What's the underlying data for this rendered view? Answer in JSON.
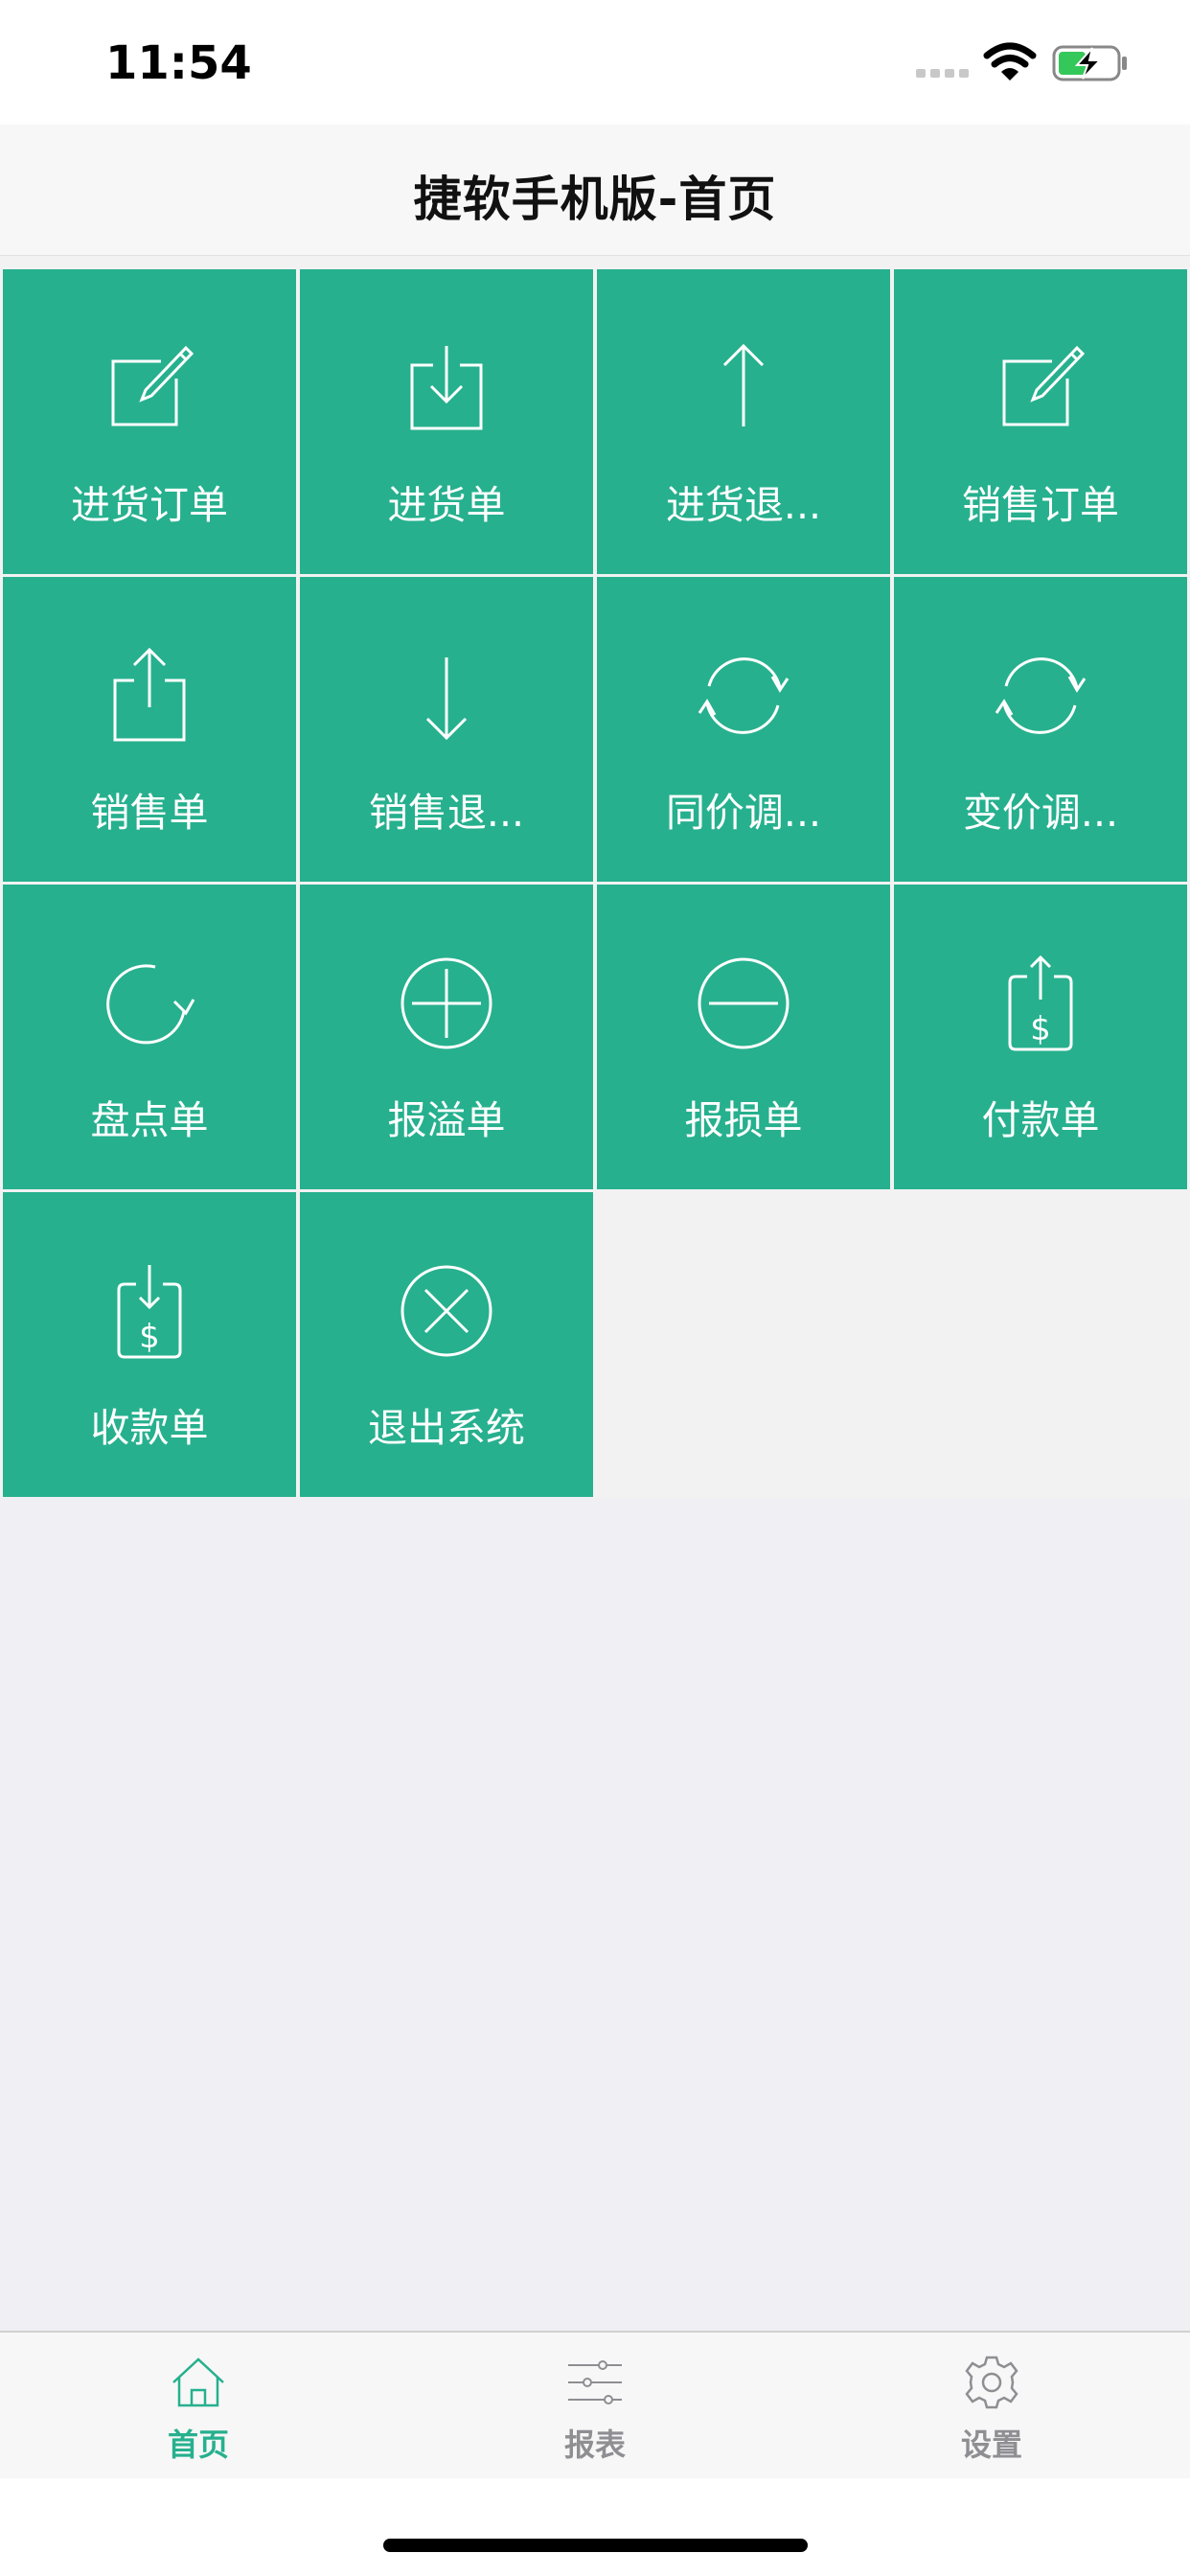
{
  "status_bar": {
    "time": "11:54"
  },
  "nav": {
    "title": "捷软手机版-首页"
  },
  "tiles": [
    {
      "label": "进货订单",
      "icon": "compose-icon"
    },
    {
      "label": "进货单",
      "icon": "download-tray-icon"
    },
    {
      "label": "进货退...",
      "icon": "arrow-up-icon"
    },
    {
      "label": "销售订单",
      "icon": "compose-icon"
    },
    {
      "label": "销售单",
      "icon": "share-upload-icon"
    },
    {
      "label": "销售退...",
      "icon": "arrow-down-icon"
    },
    {
      "label": "同价调...",
      "icon": "refresh-cycle-icon"
    },
    {
      "label": "变价调...",
      "icon": "refresh-cycle-icon"
    },
    {
      "label": "盘点单",
      "icon": "rotate-clockwise-icon"
    },
    {
      "label": "报溢单",
      "icon": "circle-plus-icon"
    },
    {
      "label": "报损单",
      "icon": "circle-minus-icon"
    },
    {
      "label": "付款单",
      "icon": "dollar-out-icon"
    },
    {
      "label": "收款单",
      "icon": "dollar-in-icon"
    },
    {
      "label": "退出系统",
      "icon": "circle-close-icon"
    }
  ],
  "tab_bar": {
    "tabs": [
      {
        "label": "首页",
        "icon": "home-icon",
        "active": true
      },
      {
        "label": "报表",
        "icon": "sliders-icon",
        "active": false
      },
      {
        "label": "设置",
        "icon": "gear-icon",
        "active": false
      }
    ],
    "active_color": "#26b08e",
    "inactive_color": "#8e8e93"
  },
  "colors": {
    "tile": "#26b08e",
    "background": "#efeff4"
  }
}
